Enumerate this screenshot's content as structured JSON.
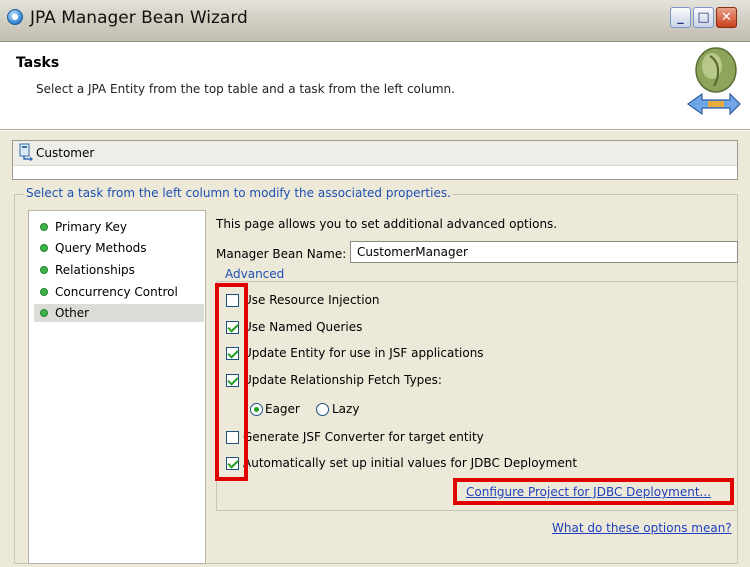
{
  "window": {
    "title": "JPA Manager Bean Wizard",
    "controls": {
      "minimize": "_",
      "maximize": "□",
      "close": "✕"
    }
  },
  "header": {
    "title": "Tasks",
    "description": "Select a JPA Entity from the top table and a task from the left column."
  },
  "entity": {
    "name": "Customer",
    "icon": "entity-icon"
  },
  "tasks": {
    "legend": "Select a task from the left column to modify the associated properties.",
    "items": [
      {
        "label": "Primary Key",
        "selected": false
      },
      {
        "label": "Query Methods",
        "selected": false
      },
      {
        "label": "Relationships",
        "selected": false
      },
      {
        "label": "Concurrency Control",
        "selected": false
      },
      {
        "label": "Other",
        "selected": true
      }
    ]
  },
  "page": {
    "description": "This page allows you to set additional advanced options.",
    "manager_bean_label": "Manager Bean Name:",
    "manager_bean_value": "CustomerManager"
  },
  "advanced": {
    "legend": "Advanced",
    "options": [
      {
        "label": "Use Resource Injection",
        "checked": false
      },
      {
        "label": "Use Named Queries",
        "checked": true
      },
      {
        "label": "Update Entity for use in JSF applications",
        "checked": true
      },
      {
        "label": "Update Relationship Fetch Types:",
        "checked": true
      },
      {
        "label": "Generate JSF Converter for target entity",
        "checked": false
      },
      {
        "label": "Automatically set up initial values for JDBC Deployment",
        "checked": true
      }
    ],
    "fetch_types": [
      {
        "label": "Eager",
        "selected": true
      },
      {
        "label": "Lazy",
        "selected": false
      }
    ],
    "configure_link": "Configure Project for JDBC Deployment..."
  },
  "help_link": "What do these options mean?",
  "colors": {
    "highlight": "#e00000",
    "link": "#1f3fbf",
    "legend": "#1e4fb3",
    "status_dot": "#3eb34a"
  }
}
